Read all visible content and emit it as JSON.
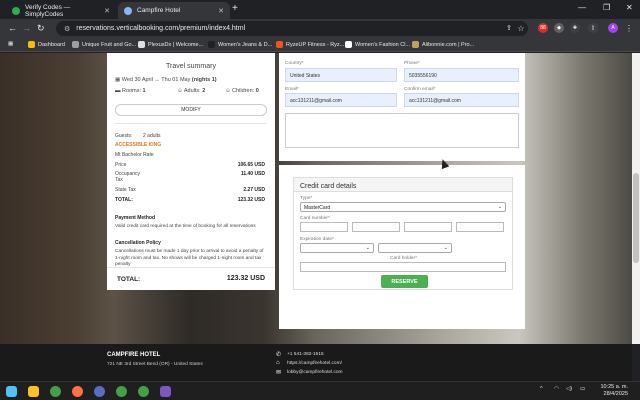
{
  "browser": {
    "tabs": [
      {
        "label": "Verify Codes — SimplyCodes",
        "active": false
      },
      {
        "label": "Campfire Hotel",
        "active": true
      }
    ],
    "url": "reservations.verticalbooking.com/premium/index4.html",
    "bookmarks": [
      "Dashboard",
      "Unique Fruit and Go...",
      "PlexusDx | Welcome...",
      "Women's Jeans & D...",
      "RyzeUP Fitness - Ryz...",
      "Women's Fashion Cl...",
      "Alibonnie.com | Pro..."
    ]
  },
  "summary": {
    "title": "Travel summary",
    "checkin": "Wed 30 April",
    "checkout": "Thu 01 May",
    "nights": "(nights 1)",
    "rooms_label": "Rooms:",
    "rooms": "1",
    "adults_label": "Adults:",
    "adults": "2",
    "children_label": "Children:",
    "children": "0",
    "modify_label": "MODIFY",
    "guests_label": "Guests:",
    "guests_value": "2 adults",
    "room_type": "ACCESSIBLE KING",
    "rate_name": "Mt Bachelor Rate",
    "price_label": "Price",
    "price_value": "106.65 USD",
    "occupancy_label": "Occupancy",
    "tax_label": "Tax",
    "occupancy_tax_value": "11.40 USD",
    "state_tax_label": "State Tax",
    "state_tax_value": "2.27 USD",
    "subtotal_label": "TOTAL:",
    "subtotal_value": "123.32 USD",
    "payment_method_title": "Payment Method",
    "payment_method_text": "Valid credit card required at the time of booking for all reservations",
    "cancellation_title": "Cancellation Policy",
    "cancellation_text": "Cancellations must be made 1 day prior to arrival to avoid a penalty of 1-night room and tax. No shows will be charged 1-night room and tax penalty",
    "total_label": "TOTAL:",
    "total_value": "123.32 USD"
  },
  "form": {
    "country_label": "Country*",
    "country_value": "United States",
    "phone_label": "Phone*",
    "phone_value": "5035556190",
    "email_label": "Email*",
    "email_value": "acc131211@gmail.com",
    "confirm_email_label": "Confirm email*",
    "confirm_email_value": "acc131211@gmail.com"
  },
  "payment": {
    "title": "Credit card details",
    "type_label": "Type*",
    "type_value": "MasterCard",
    "card_number_label": "Card number*",
    "expiration_label": "Expiration date*",
    "card_holder_label": "Card holder*",
    "reserve_label": "RESERVE"
  },
  "footer": {
    "hotel_name": "CAMPFIRE HOTEL",
    "address": "721 NE 3rd Street Bend (OR) - United States",
    "phone": "+1 541-382-1515",
    "website": "https://campfirehotel.com/",
    "email": "lobby@campfirehotel.com"
  },
  "taskbar": {
    "time": "10:25 a. m.",
    "date": "28/4/2025"
  }
}
